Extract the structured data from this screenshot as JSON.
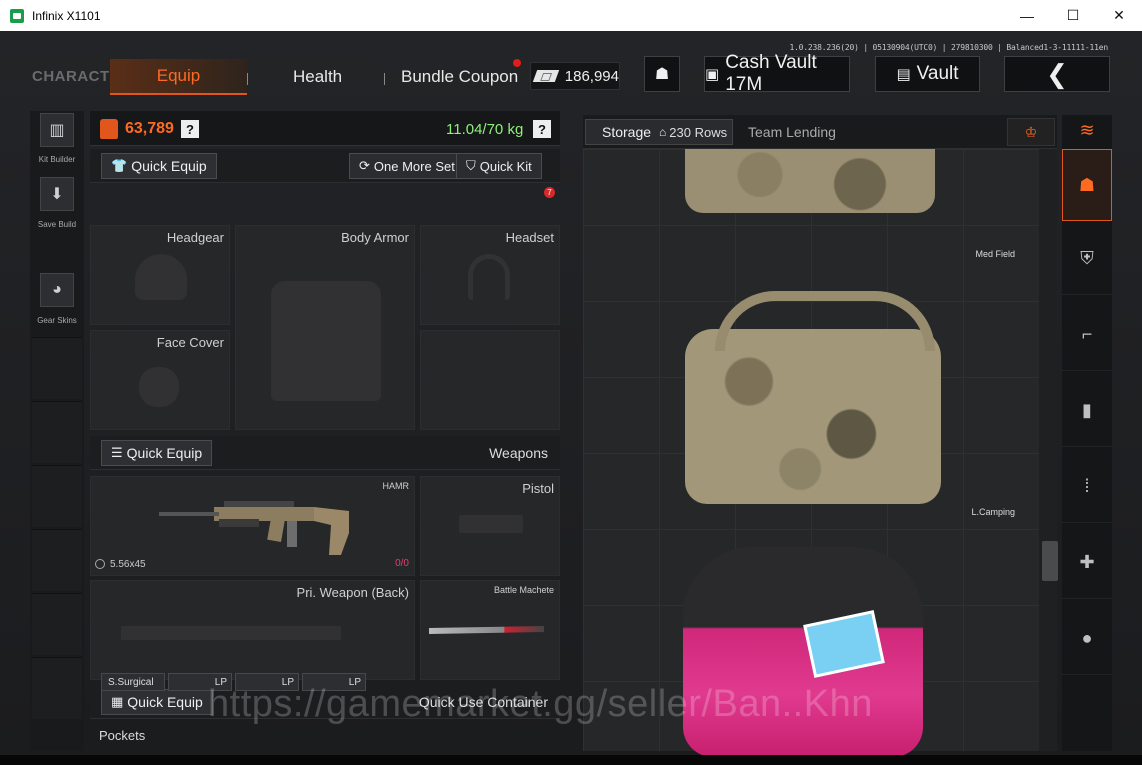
{
  "window": {
    "title": "Infinix X1101",
    "minimize": "—",
    "maximize": "☐",
    "close": "✕"
  },
  "version": "1.0.238.236(20) | 05130904(UTC0) | 279810300 | Balanced1-3-11111-11en",
  "nav": {
    "character": "CHARACTER",
    "equip": "Equip",
    "health": "Health",
    "bundle_coupon": "Bundle Coupon",
    "cash": "186,994",
    "cash_vault": "Cash Vault 17M",
    "vault": "Vault",
    "back": "❮"
  },
  "left_sidebar": {
    "kit_builder": "Kit Builder",
    "save_build": "Save Build",
    "gear_skins": "Gear Skins"
  },
  "loadout": {
    "value": "63,789",
    "weight": "11.04/70 kg",
    "help": "?",
    "gear": {
      "quick_equip": "Quick Equip",
      "one_more_set": "One More Set",
      "quick_kit": "Quick Kit",
      "quick_kit_badge": "7",
      "slots": {
        "headgear": "Headgear",
        "body_armor": "Body Armor",
        "headset": "Headset",
        "face_cover": "Face Cover"
      }
    },
    "weapons": {
      "quick_equip": "Quick Equip",
      "title": "Weapons",
      "primary_name": "HAMR",
      "primary_ammo": "5.56x45",
      "primary_mag": "0/0",
      "pistol": "Pistol",
      "pri_back": "Pri. Weapon (Back)",
      "melee": "Battle Machete"
    },
    "quick_use": {
      "quick_equip": "Quick Equip",
      "title": "Quick Use Container"
    },
    "pockets": {
      "title": "Pockets",
      "items": [
        "S.Surgical",
        "LP",
        "LP",
        "LP"
      ]
    }
  },
  "storage": {
    "tab": "Storage",
    "rows": "230 Rows",
    "team_lending": "Team Lending",
    "items": [
      "Med Field",
      "L.Camping"
    ]
  },
  "watermark": "https://gamemarket.gg/seller/Ban..Khn",
  "colors": {
    "accent": "#ff6a22",
    "weight_ok": "#8ff07a",
    "badge": "#d42a2a"
  }
}
